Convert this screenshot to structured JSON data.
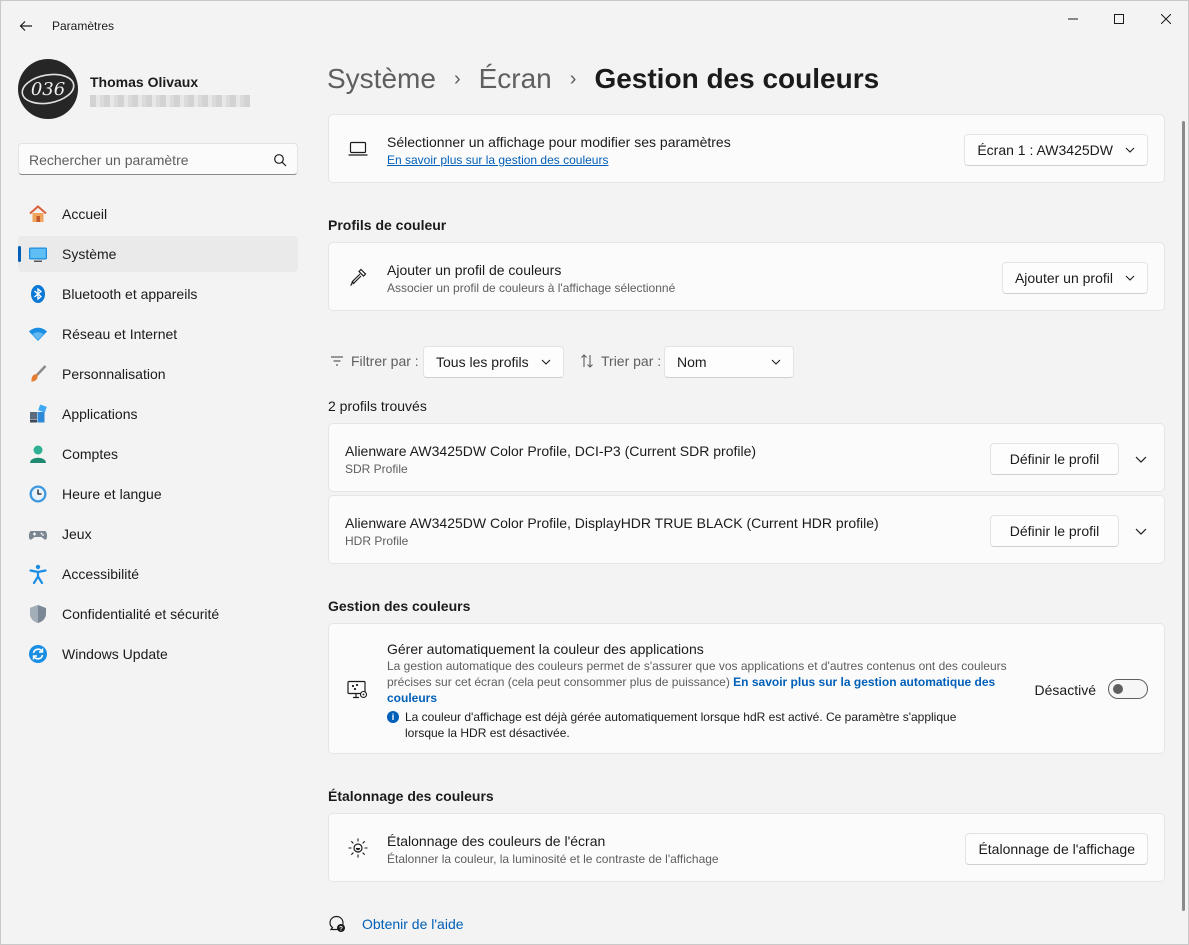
{
  "window": {
    "title": "Paramètres"
  },
  "user": {
    "name": "Thomas Olivaux",
    "avatar_text": "036"
  },
  "search": {
    "placeholder": "Rechercher un paramètre"
  },
  "sidebar": {
    "items": [
      {
        "label": "Accueil",
        "icon": "home-icon"
      },
      {
        "label": "Système",
        "icon": "system-icon",
        "active": true
      },
      {
        "label": "Bluetooth et appareils",
        "icon": "bluetooth-icon"
      },
      {
        "label": "Réseau et Internet",
        "icon": "wifi-icon"
      },
      {
        "label": "Personnalisation",
        "icon": "brush-icon"
      },
      {
        "label": "Applications",
        "icon": "apps-icon"
      },
      {
        "label": "Comptes",
        "icon": "account-icon"
      },
      {
        "label": "Heure et langue",
        "icon": "clock-globe-icon"
      },
      {
        "label": "Jeux",
        "icon": "gamepad-icon"
      },
      {
        "label": "Accessibilité",
        "icon": "accessibility-icon"
      },
      {
        "label": "Confidentialité et sécurité",
        "icon": "shield-icon"
      },
      {
        "label": "Windows Update",
        "icon": "update-icon"
      }
    ]
  },
  "breadcrumb": {
    "items": [
      "Système",
      "Écran"
    ],
    "current": "Gestion des couleurs"
  },
  "display_select": {
    "title": "Sélectionner un affichage pour modifier ses paramètres",
    "link": "En savoir plus sur la gestion des couleurs",
    "dropdown_value": "Écran 1 : AW3425DW"
  },
  "color_profiles": {
    "section_title": "Profils de couleur",
    "add_title": "Ajouter un profil de couleurs",
    "add_sub": "Associer un profil de couleurs à l'affichage sélectionné",
    "add_button": "Ajouter un profil",
    "filter_label": "Filtrer par :",
    "filter_value": "Tous les profils",
    "sort_label": "Trier par :",
    "sort_value": "Nom",
    "count_text": "2 profils trouvés",
    "profiles": [
      {
        "name": "Alienware AW3425DW Color Profile, DCI-P3 (Current SDR profile)",
        "type": "SDR Profile",
        "button": "Définir le profil"
      },
      {
        "name": "Alienware AW3425DW Color Profile, DisplayHDR TRUE BLACK (Current HDR profile)",
        "type": "HDR Profile",
        "button": "Définir le profil"
      }
    ]
  },
  "color_management": {
    "section_title": "Gestion des couleurs",
    "title": "Gérer automatiquement la couleur des applications",
    "desc": "La gestion automatique des couleurs permet de s'assurer que vos applications et d'autres contenus ont des couleurs précises sur cet écran (cela peut consommer plus de puissance)",
    "desc_link": "En savoir plus sur la gestion automatique des couleurs",
    "info": "La couleur d'affichage est déjà gérée automatiquement lorsque hdR est activé. Ce paramètre s'applique lorsque la HDR est désactivée.",
    "toggle_label": "Désactivé",
    "toggle_on": false
  },
  "calibration": {
    "section_title": "Étalonnage des couleurs",
    "title": "Étalonnage des couleurs de l'écran",
    "sub": "Étalonner la couleur, la luminosité et le contraste de l'affichage",
    "button": "Étalonnage de l'affichage"
  },
  "help": {
    "label": "Obtenir de l'aide"
  },
  "colors": {
    "accent": "#005fb8",
    "background": "#f3f3f3",
    "card": "#fbfbfb"
  }
}
